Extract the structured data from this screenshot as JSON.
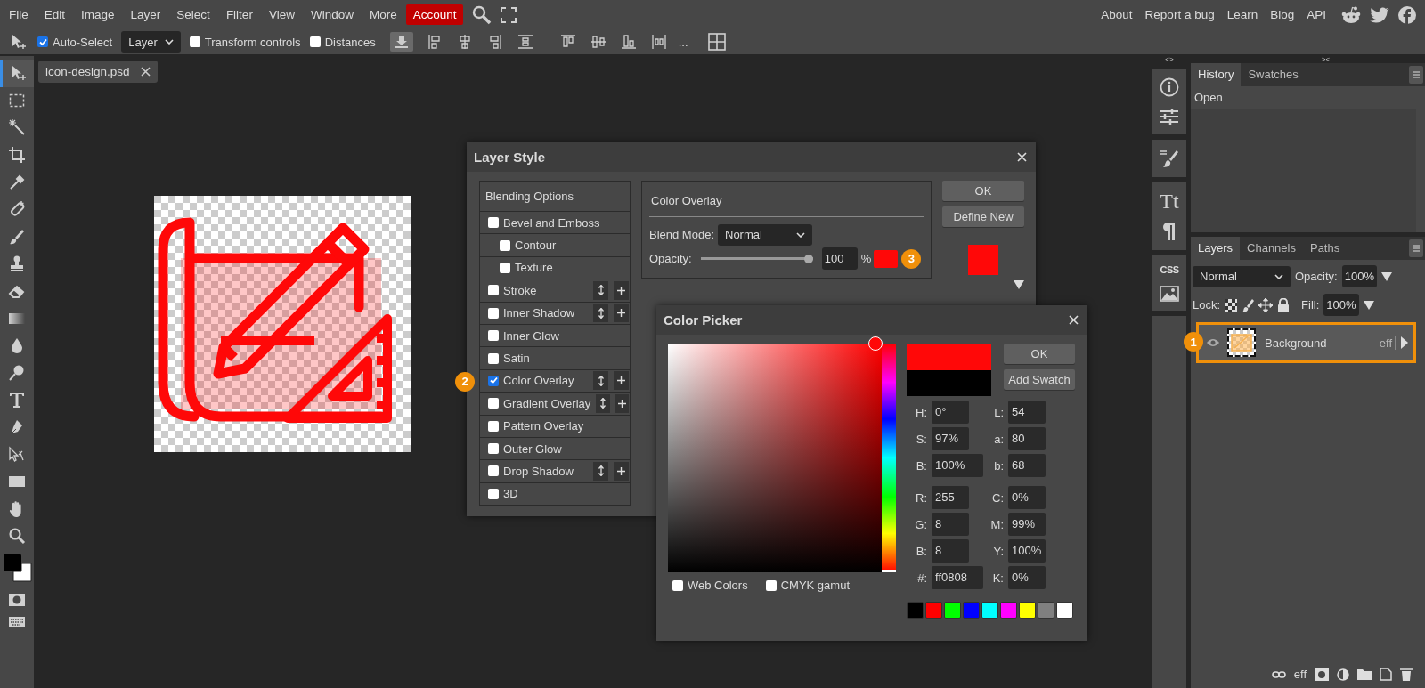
{
  "menu": [
    {
      "label": "File",
      "highlighted": false
    },
    {
      "label": "Edit",
      "highlighted": false
    },
    {
      "label": "Image",
      "highlighted": false
    },
    {
      "label": "Layer",
      "highlighted": false
    },
    {
      "label": "Select",
      "highlighted": false
    },
    {
      "label": "Filter",
      "highlighted": false
    },
    {
      "label": "View",
      "highlighted": false
    },
    {
      "label": "Window",
      "highlighted": false
    },
    {
      "label": "More",
      "highlighted": false
    },
    {
      "label": "Account",
      "highlighted": true
    }
  ],
  "links": [
    "About",
    "Report a bug",
    "Learn",
    "Blog",
    "API"
  ],
  "options_bar": {
    "checks": [
      {
        "label": "Auto-Select",
        "checked": true
      },
      {
        "label": "Transform controls",
        "checked": false
      },
      {
        "label": "Distances",
        "checked": false
      }
    ],
    "target": "Layer",
    "more": "..."
  },
  "tools": [
    {
      "kind": "move",
      "selected": true
    },
    {
      "kind": "marquee",
      "selected": false
    },
    {
      "kind": "wand",
      "selected": false
    },
    {
      "kind": "crop",
      "selected": false
    },
    {
      "kind": "eyedropper",
      "selected": false
    },
    {
      "kind": "healing",
      "selected": false
    },
    {
      "kind": "brush",
      "selected": false
    },
    {
      "kind": "stamp",
      "selected": false
    },
    {
      "kind": "eraser",
      "selected": false
    },
    {
      "kind": "gradient",
      "selected": false
    },
    {
      "kind": "blur",
      "selected": false
    },
    {
      "kind": "dodge",
      "selected": false
    },
    {
      "kind": "type",
      "selected": false
    },
    {
      "kind": "pen",
      "selected": false
    },
    {
      "kind": "pathselect",
      "selected": false
    },
    {
      "kind": "shape",
      "selected": false
    },
    {
      "kind": "hand",
      "selected": false
    },
    {
      "kind": "zoom",
      "selected": false
    }
  ],
  "color_swatches": [
    {
      "color": "#000000"
    },
    {
      "color": "#ffffff"
    }
  ],
  "document_tab": {
    "title": "icon-design.psd"
  },
  "side_panel": {
    "collapse_labels": [
      "<>",
      "><"
    ],
    "character_label": "Tt",
    "css_label": "CSS"
  },
  "history_panel": {
    "tabs": [
      {
        "label": "History",
        "selected": true
      },
      {
        "label": "Swatches",
        "selected": false
      }
    ],
    "items": [
      "Open"
    ]
  },
  "layers_panel": {
    "tabs": [
      {
        "label": "Layers",
        "selected": true
      },
      {
        "label": "Channels",
        "selected": false
      },
      {
        "label": "Paths",
        "selected": false
      }
    ],
    "blend_mode": "Normal",
    "opacity_label": "Opacity:",
    "opacity": "100%",
    "lock_label": "Lock:",
    "fill_label": "Fill:",
    "fill": "100%",
    "layers": [
      {
        "name": "Background",
        "effects": "eff",
        "visible": true,
        "selected": true,
        "highlighted": true,
        "badge": "1"
      }
    ],
    "footer_effects": "eff"
  },
  "layer_style": {
    "title": "Layer Style",
    "header": "Blending Options",
    "styles": [
      {
        "label": "Bevel and Emboss",
        "checked": false,
        "has_controls": false,
        "children": [
          {
            "label": "Contour",
            "checked": false
          },
          {
            "label": "Texture",
            "checked": false
          }
        ]
      },
      {
        "label": "Stroke",
        "checked": false,
        "has_controls": true
      },
      {
        "label": "Inner Shadow",
        "checked": false,
        "has_controls": true
      },
      {
        "label": "Inner Glow",
        "checked": false,
        "has_controls": false
      },
      {
        "label": "Satin",
        "checked": false,
        "has_controls": false
      },
      {
        "label": "Color Overlay",
        "checked": true,
        "has_controls": true,
        "badge": "2"
      },
      {
        "label": "Gradient Overlay",
        "checked": false,
        "has_controls": true
      },
      {
        "label": "Pattern Overlay",
        "checked": false,
        "has_controls": false
      },
      {
        "label": "Outer Glow",
        "checked": false,
        "has_controls": false
      },
      {
        "label": "Drop Shadow",
        "checked": false,
        "has_controls": true
      },
      {
        "label": "3D",
        "checked": false,
        "has_controls": false
      }
    ],
    "section_title": "Color Overlay",
    "blend_mode_label": "Blend Mode:",
    "blend_mode": "Normal",
    "opacity_label": "Opacity:",
    "opacity": {
      "level": 1.0
    },
    "opacity_value": "100",
    "opacity_unit": "%",
    "color": "#ff0808",
    "color_badge": "3",
    "buttons": [
      "OK",
      "Define New"
    ]
  },
  "color_picker": {
    "title": "Color Picker",
    "hue": {
      "level": 0
    },
    "preview": [
      {
        "color": "#ff0808"
      },
      {
        "color": "#000000"
      }
    ],
    "buttons": [
      "OK",
      "Add Swatch"
    ],
    "field_groups": [
      [
        [
          {
            "label": "H:",
            "value": "0°"
          },
          {
            "label": "L:",
            "value": "54"
          }
        ],
        [
          {
            "label": "S:",
            "value": "97%"
          },
          {
            "label": "a:",
            "value": "80"
          }
        ],
        [
          {
            "label": "B:",
            "value": "100%"
          },
          {
            "label": "b:",
            "value": "68"
          }
        ]
      ],
      [
        [
          {
            "label": "R:",
            "value": "255"
          },
          {
            "label": "C:",
            "value": "0%"
          }
        ],
        [
          {
            "label": "G:",
            "value": "8"
          },
          {
            "label": "M:",
            "value": "99%"
          }
        ],
        [
          {
            "label": "B:",
            "value": "8"
          },
          {
            "label": "Y:",
            "value": "100%"
          }
        ],
        [
          {
            "label": "#:",
            "value": "ff0808"
          },
          {
            "label": "K:",
            "value": "0%"
          }
        ]
      ]
    ],
    "options": [
      {
        "label": "Web Colors",
        "checked": false
      },
      {
        "label": "CMYK gamut",
        "checked": false
      }
    ],
    "swatches": [
      {
        "color": "#000000"
      },
      {
        "color": "#ff0000"
      },
      {
        "color": "#00ff00"
      },
      {
        "color": "#0000ff"
      },
      {
        "color": "#00ffff"
      },
      {
        "color": "#ff00ff"
      },
      {
        "color": "#ffff00"
      },
      {
        "color": "#808080"
      },
      {
        "color": "#ffffff"
      }
    ]
  }
}
